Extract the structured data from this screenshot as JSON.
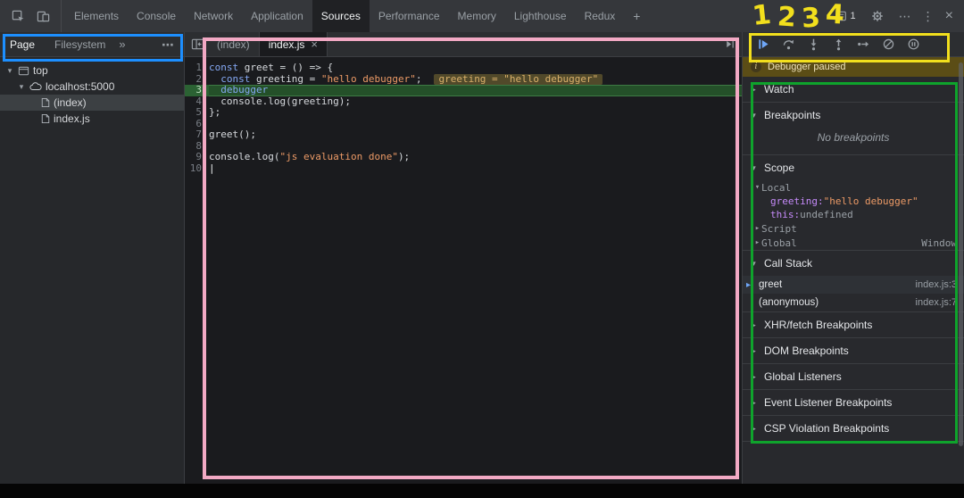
{
  "topbar": {
    "tabs": [
      "Elements",
      "Console",
      "Network",
      "Application",
      "Sources",
      "Performance",
      "Memory",
      "Lighthouse",
      "Redux"
    ],
    "selected_tab": "Sources",
    "add_tab_label": "+",
    "issues_count": "1"
  },
  "navigator": {
    "tabs": [
      "Page",
      "Filesystem"
    ],
    "selected_tab": "Page",
    "tree": [
      {
        "label": "top",
        "icon": "frame-icon",
        "depth": 0,
        "caret": "expanded",
        "selected": false
      },
      {
        "label": "localhost:5000",
        "icon": "cloud-icon",
        "depth": 1,
        "caret": "expanded",
        "selected": false
      },
      {
        "label": "(index)",
        "icon": "file-icon",
        "depth": 2,
        "caret": "none",
        "selected": true
      },
      {
        "label": "index.js",
        "icon": "file-icon",
        "depth": 2,
        "caret": "none",
        "selected": false
      }
    ]
  },
  "editor": {
    "tabs": [
      {
        "label": "(index)",
        "active": false
      },
      {
        "label": "index.js",
        "active": true,
        "close": "×"
      }
    ],
    "lines": [
      {
        "num": "1",
        "tokens": [
          [
            "kw",
            "const"
          ],
          [
            "txt",
            " greet = () => {"
          ]
        ]
      },
      {
        "num": "2",
        "tokens": [
          [
            "txt",
            "  "
          ],
          [
            "kw",
            "const"
          ],
          [
            "txt",
            " greeting = "
          ],
          [
            "str",
            "\"hello debugger\""
          ],
          [
            "txt",
            ";"
          ]
        ],
        "chip": "greeting = \"hello debugger\""
      },
      {
        "num": "3",
        "tokens": [
          [
            "txt",
            "  "
          ],
          [
            "kw",
            "debugger"
          ]
        ],
        "exec": true
      },
      {
        "num": "4",
        "tokens": [
          [
            "txt",
            "  console."
          ],
          [
            "txt",
            "log"
          ],
          [
            "txt",
            "(greeting);"
          ]
        ]
      },
      {
        "num": "5",
        "tokens": [
          [
            "txt",
            "};"
          ]
        ]
      },
      {
        "num": "6",
        "tokens": []
      },
      {
        "num": "7",
        "tokens": [
          [
            "txt",
            "greet();"
          ]
        ]
      },
      {
        "num": "8",
        "tokens": []
      },
      {
        "num": "9",
        "tokens": [
          [
            "txt",
            "console."
          ],
          [
            "txt",
            "log"
          ],
          [
            "txt",
            "("
          ],
          [
            "str",
            "\"js evaluation done\""
          ],
          [
            "txt",
            ");"
          ]
        ]
      },
      {
        "num": "10",
        "tokens": [
          [
            "cur",
            "|"
          ]
        ]
      }
    ]
  },
  "debugger": {
    "toolbar": [
      {
        "name": "resume",
        "accent": true
      },
      {
        "name": "step-over"
      },
      {
        "name": "step-into"
      },
      {
        "name": "step-out"
      },
      {
        "name": "step"
      },
      {
        "name": "deactivate-breakpoints"
      },
      {
        "name": "pause-on-exceptions"
      }
    ],
    "paused_message": "Debugger paused",
    "breakpoints_empty_message": "No breakpoints",
    "sections": [
      {
        "label": "Watch",
        "collapsed": true
      },
      {
        "label": "Breakpoints",
        "collapsed": false,
        "content": "breakpoints"
      },
      {
        "label": "Scope",
        "collapsed": false,
        "content": "scope"
      },
      {
        "label": "Call Stack",
        "collapsed": false,
        "content": "callstack"
      },
      {
        "label": "XHR/fetch Breakpoints",
        "collapsed": true
      },
      {
        "label": "DOM Breakpoints",
        "collapsed": true
      },
      {
        "label": "Global Listeners",
        "collapsed": true
      },
      {
        "label": "Event Listener Breakpoints",
        "collapsed": true
      },
      {
        "label": "CSP Violation Breakpoints",
        "collapsed": true
      }
    ],
    "scope": [
      {
        "label": "Local",
        "caret": "expanded",
        "entries": [
          {
            "name": "greeting",
            "value": "\"hello debugger\"",
            "kind": "string"
          },
          {
            "name": "this",
            "value": "undefined",
            "kind": "undefined"
          }
        ]
      },
      {
        "label": "Script",
        "caret": "collapsed",
        "entries": []
      },
      {
        "label": "Global",
        "caret": "collapsed",
        "hint": "Window",
        "entries": []
      }
    ],
    "call_stack": [
      {
        "name": "greet",
        "location": "index.js:3",
        "current": true
      },
      {
        "name": "(anonymous)",
        "location": "index.js:7",
        "current": false
      }
    ]
  },
  "annotations": {
    "numbers": [
      "1",
      "2",
      "3",
      "4"
    ],
    "colors": {
      "navigator_box": "#1d8fff",
      "editor_box": "#f2a9c4",
      "toolbar_box": "#f2df1d",
      "sidebar_box": "#0fa32c",
      "numbers": "#f2df1d"
    }
  },
  "ui_glyphs": {
    "close": "×",
    "kebab": "⋮",
    "more": "⋯",
    "chevrons": "»",
    "caret_collapsed": "▸",
    "caret_expanded": "▾",
    "info": "i"
  },
  "colors": {
    "keyword": "#85a8f3",
    "string": "#ec9a66",
    "code_text": "#d7dade",
    "exec_line_bg": "#245029",
    "exec_line_border": "#3d7a44",
    "chip_bg": "#51492a",
    "chip_text": "#d9b06a",
    "variable_name": "#c58af9",
    "muted_text": "#9aa0a6",
    "accent_blue": "#6fa7f8"
  }
}
